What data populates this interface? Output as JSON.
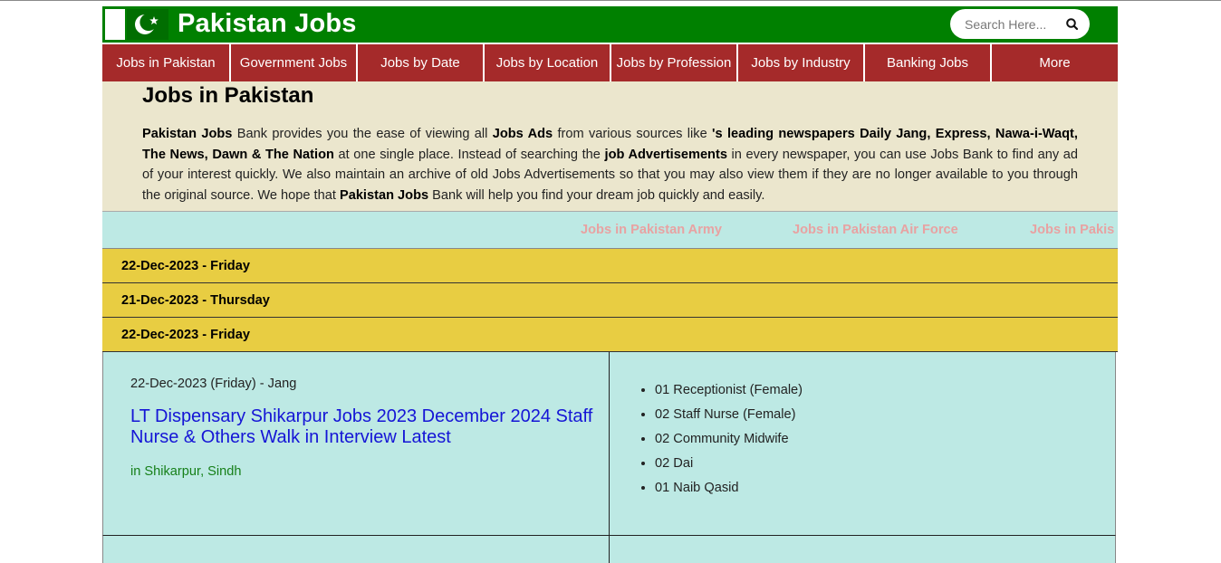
{
  "site": {
    "title": "Pakistan Jobs"
  },
  "search": {
    "placeholder": "Search Here..."
  },
  "nav": {
    "items": [
      {
        "label": "Jobs in Pakistan"
      },
      {
        "label": "Government Jobs"
      },
      {
        "label": "Jobs by Date"
      },
      {
        "label": "Jobs by Location"
      },
      {
        "label": "Jobs by Profession"
      },
      {
        "label": "Jobs by Industry"
      },
      {
        "label": "Banking Jobs"
      },
      {
        "label": "More"
      }
    ]
  },
  "intro": {
    "heading": "Jobs in Pakistan",
    "p1_b1": "Pakistan Jobs",
    "p1_t1": " Bank provides you the ease of viewing all ",
    "p1_b2": "Jobs Ads",
    "p1_t2": " from various sources like ",
    "p1_b3": "'s leading newspapers Daily Jang, Express, Nawa-i-Waqt, The News, Dawn & The Nation",
    "p1_t3": " at one single place. Instead of searching the ",
    "p1_b4": "job Advertisements",
    "p1_t4": " in every newspaper, you can use Jobs Bank to find any ad of your interest quickly. We also maintain an archive of old Jobs Advertisements so that you may also view them if they are no longer available to you through the original source. We hope that ",
    "p1_b5": "Pakistan Jobs",
    "p1_t5": " Bank will help you find your dream job quickly and easily."
  },
  "marquee": {
    "items": [
      "Jobs in Pakistan Army",
      "Jobs in Pakistan Air Force",
      "Jobs in Pakis"
    ]
  },
  "dates": [
    "22-Dec-2023 - Friday",
    "21-Dec-2023 - Thursday",
    "22-Dec-2023 - Friday"
  ],
  "job": {
    "meta": "22-Dec-2023 (Friday) - Jang",
    "title": "LT Dispensary Shikarpur Jobs 2023 December 2024 Staff Nurse & Others Walk in Interview Latest",
    "location": "in Shikarpur, Sindh",
    "positions": [
      "01 Receptionist (Female)",
      "02 Staff Nurse (Female)",
      "02 Community Midwife",
      "02 Dai",
      "01 Naib Qasid"
    ]
  },
  "colors": {
    "header": "#008000",
    "nav": "#a52a2a",
    "intro_bg": "#ebe6cd",
    "teal_bg": "#bde9e4",
    "date_bg": "#e8cd42",
    "link": "#1515d6",
    "location": "#17801a",
    "marquee_text": "#e8a2a2"
  }
}
